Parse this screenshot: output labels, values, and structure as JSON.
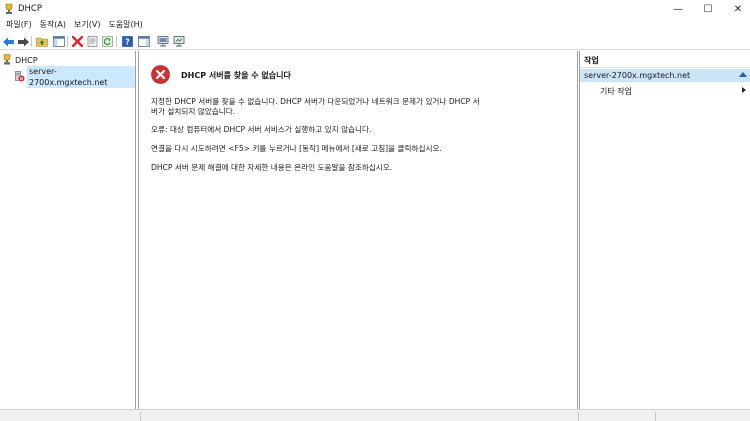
{
  "window": {
    "title": "DHCP",
    "minimize_glyph": "—",
    "maximize_glyph": "☐",
    "close_glyph": "✕"
  },
  "menu": [
    "파일(F)",
    "동작(A)",
    "보기(V)",
    "도움말(H)"
  ],
  "toolbar": {
    "icons": [
      "back-icon",
      "forward-icon",
      "up-folder-icon",
      "show-hide-tree-icon",
      "delete-icon",
      "properties-icon",
      "refresh-icon",
      "help-icon",
      "show-hide-action-pane-icon",
      "server-icon",
      "server-stats-icon"
    ]
  },
  "tree": {
    "root_label": "DHCP",
    "child_label": "server-2700x.mgxtech.net"
  },
  "main": {
    "error_title": "DHCP 서버를 찾을 수 없습니다",
    "message1": "지정한 DHCP 서버를 찾을 수 없습니다. DHCP 서버가 다운되었거나 네트워크 문제가 있거나 DHCP 서버가 설치되지 않았습니다.",
    "message2": "오류:  대상 컴퓨터에서 DHCP 서버 서비스가 실행하고 있지 않습니다.",
    "message3": "연결을 다시 시도하려면 <F5> 키를 누르거나 [동작] 메뉴에서 [새로 고침]을 클릭하십시오.",
    "message4": "DHCP 서버 문제 해결에 대한 자세한 내용은 온라인 도움말을 참조하십시오."
  },
  "actions": {
    "header": "작업",
    "section_label": "server-2700x.mgxtech.net",
    "item_label": "기타 작업"
  },
  "colors": {
    "selection": "#cce8ff",
    "action_section": "#cce4f7",
    "error_red": "#d0302f"
  }
}
